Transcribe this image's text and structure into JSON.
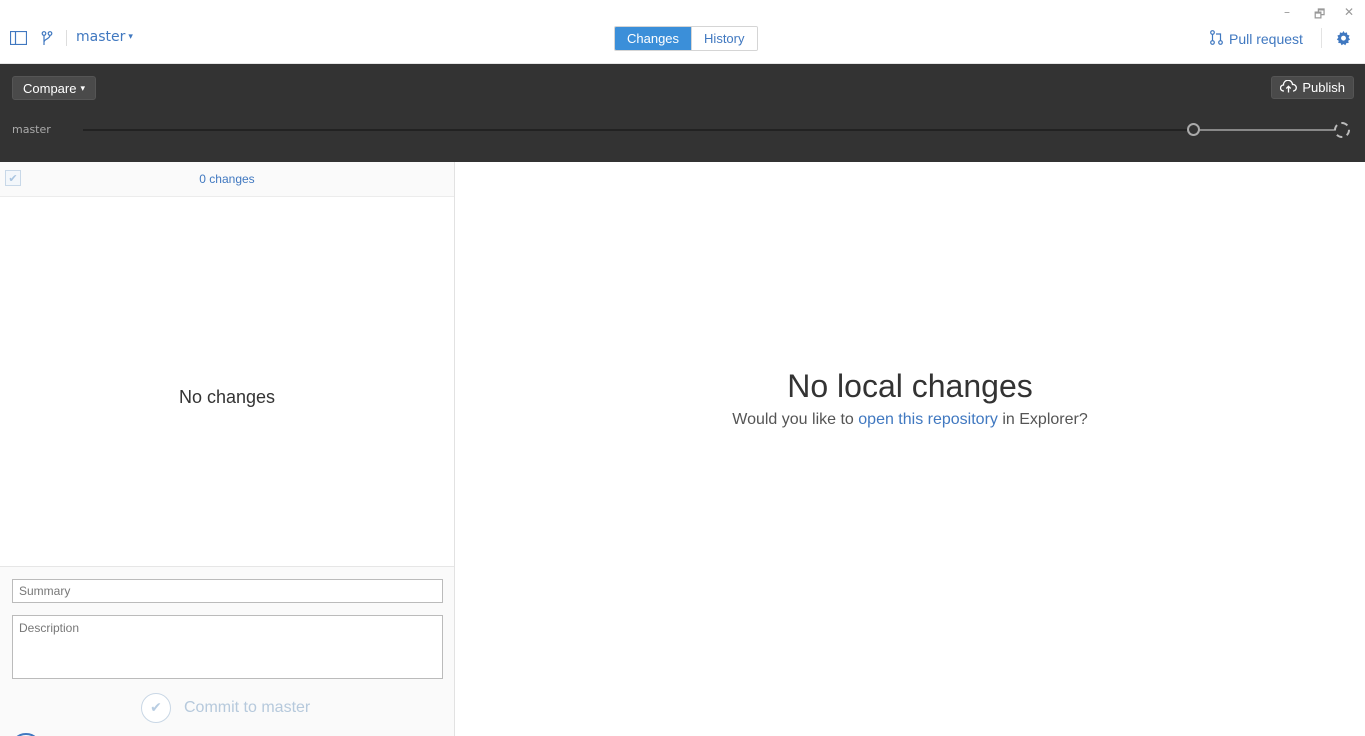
{
  "topbar": {
    "branch": "master",
    "tabs": [
      {
        "label": "Changes",
        "active": true
      },
      {
        "label": "History",
        "active": false
      }
    ],
    "pull_request_label": "Pull request",
    "icons": {
      "sidebar_toggle": "sidebar-toggle-icon",
      "branch": "git-branch-icon",
      "pull_request": "pull-request-icon",
      "settings": "gear-icon"
    }
  },
  "window_controls": {
    "minimize": "–",
    "restore": "🗗",
    "close": "✕"
  },
  "compare_bar": {
    "compare_label": "Compare",
    "publish_label": "Publish",
    "branch_label": "master"
  },
  "left_panel": {
    "changes_count_label": "0 changes",
    "empty_label": "No changes",
    "summary_placeholder": "Summary",
    "description_placeholder": "Description",
    "commit_label": "Commit to master"
  },
  "right_panel": {
    "title": "No local changes",
    "sub_prefix": "Would you like to ",
    "sub_link": "open this repository",
    "sub_suffix": " in Explorer?"
  },
  "colors": {
    "accent": "#4078c0",
    "tab_active_bg": "#3b8fd9",
    "dark_bar": "#333333"
  }
}
